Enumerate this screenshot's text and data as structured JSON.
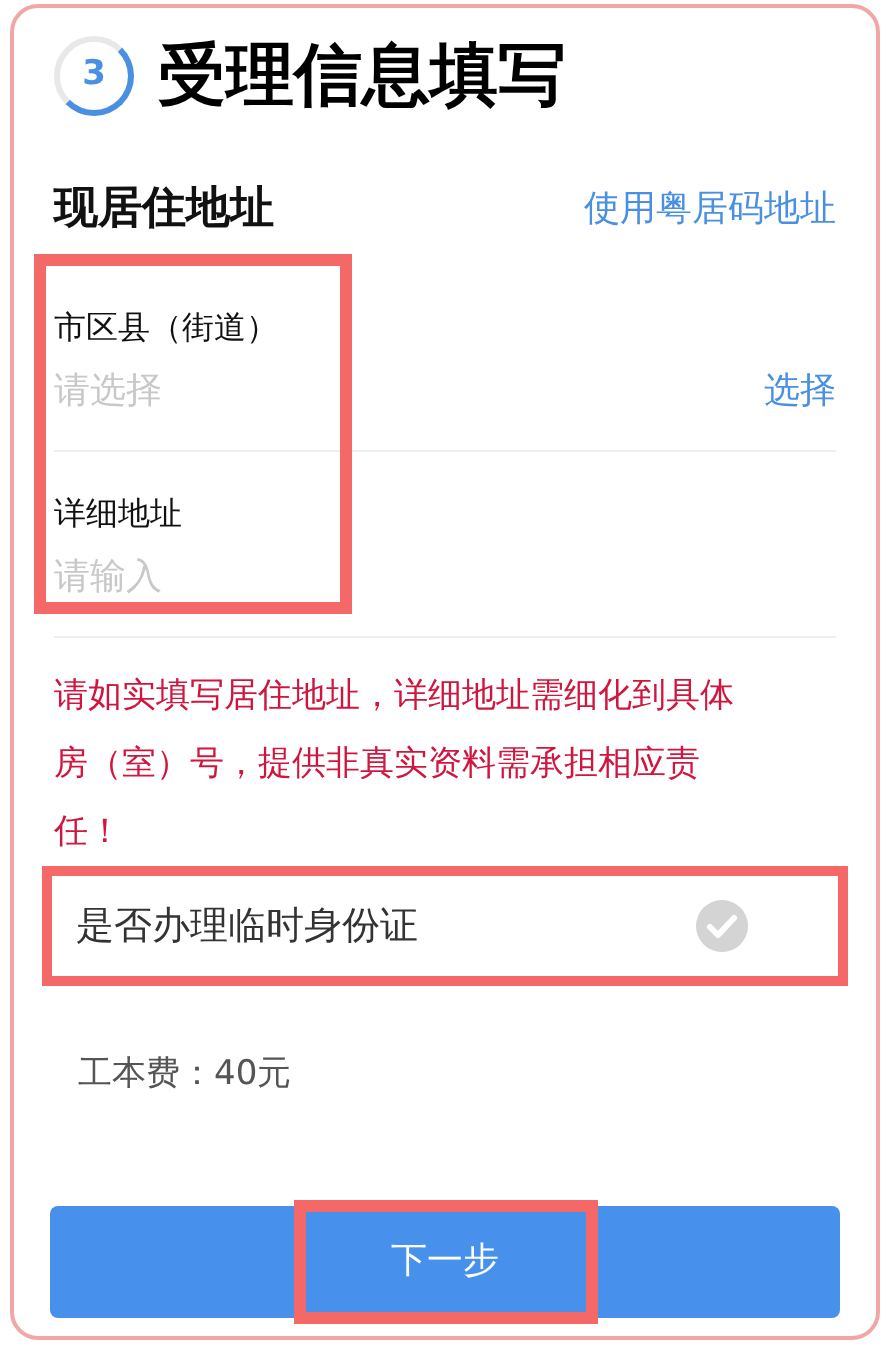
{
  "step": {
    "number": "3",
    "title": "受理信息填写"
  },
  "section": {
    "title": "现居住地址",
    "link": "使用粤居码地址"
  },
  "fields": [
    {
      "label": "市区县（街道）",
      "placeholder": "请选择",
      "action": "选择"
    },
    {
      "label": "详细地址",
      "placeholder": "请输入"
    }
  ],
  "warning": "请如实填写居住地址，详细地址需细化到具体房（室）号，提供非真实资料需承担相应责任！",
  "option": {
    "label": "是否办理临时身份证",
    "checked": false
  },
  "fee": "工本费：40元",
  "button": "下一步"
}
